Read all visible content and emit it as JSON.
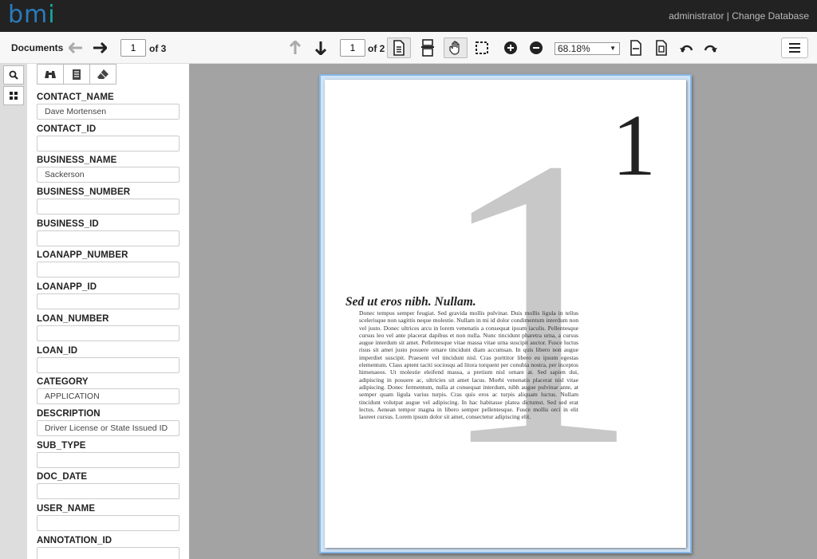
{
  "header": {
    "logo_b": "bm",
    "logo_i": "i",
    "user": "administrator",
    "separator": " | ",
    "change_db": "Change Database"
  },
  "toolbar": {
    "documents_label": "Documents",
    "doc_page": "1",
    "doc_of": "of 3",
    "page_num": "1",
    "page_of": "of 2",
    "zoom": "68.18%"
  },
  "panel": {
    "fields": [
      {
        "label": "CONTACT_NAME",
        "value": "Dave Mortensen"
      },
      {
        "label": "CONTACT_ID",
        "value": ""
      },
      {
        "label": "BUSINESS_NAME",
        "value": "Sackerson"
      },
      {
        "label": "BUSINESS_NUMBER",
        "value": ""
      },
      {
        "label": "BUSINESS_ID",
        "value": ""
      },
      {
        "label": "LOANAPP_NUMBER",
        "value": ""
      },
      {
        "label": "LOANAPP_ID",
        "value": ""
      },
      {
        "label": "LOAN_NUMBER",
        "value": ""
      },
      {
        "label": "LOAN_ID",
        "value": ""
      },
      {
        "label": "CATEGORY",
        "value": "APPLICATION"
      },
      {
        "label": "DESCRIPTION",
        "value": "Driver License or State Issued ID"
      },
      {
        "label": "SUB_TYPE",
        "value": ""
      },
      {
        "label": "DOC_DATE",
        "value": ""
      },
      {
        "label": "USER_NAME",
        "value": ""
      },
      {
        "label": "ANNOTATION_ID",
        "value": ""
      }
    ]
  },
  "document": {
    "big_number": "1",
    "small_number": "1",
    "heading": "Sed ut eros nibh. Nullam.",
    "body": "Donec tempus semper feugiat. Sed gravida mollis pulvinar. Duis mollis ligula in tellus scelerisque non sagittis neque molestie. Nullam in mi id dolor condimentum interdum non vel justo. Donec ultrices arcu in lorem venenatis a consequat ipsum iaculis. Pellentesque cursus leo vel ante placerat dapibus et non nulla. Nunc tincidunt pharetra urna, a cursus augue interdum sit amet. Pellentesque vitae massa vitae urna suscipit auctor. Fusce luctus risus sit amet justo posuere ornare tincidunt diam accumsan. In quis libero non augue imperdiet suscipit. Praesent vel tincidunt nisl. Cras porttitor libero eu ipsum egestas elementum. Class aptent taciti sociosqu ad litora torquent per conubia nostra, per inceptos himenaeos. Ut molestie eleifend massa, a pretium nisl ornare at. Sed sapien dui, adipiscing in posuere ac, ultricies sit amet lacus. Morbi venenatis placerat nisl vitae adipiscing. Donec fermentum, nulla at consequat interdum, nibh augue pulvinar ante, at semper quam ligula varius turpis. Cras quis eros ac turpis aliquam luctus. Nullam tincidunt volutpat augue vel adipiscing. In hac habitasse platea dictumst. Sed sed erat lectus. Aenean tempor magna in libero semper pellentesque. Fusce mollis orci in elit laoreet cursus. Lorem ipsum dolor sit amet, consectetur adipiscing elit."
  }
}
